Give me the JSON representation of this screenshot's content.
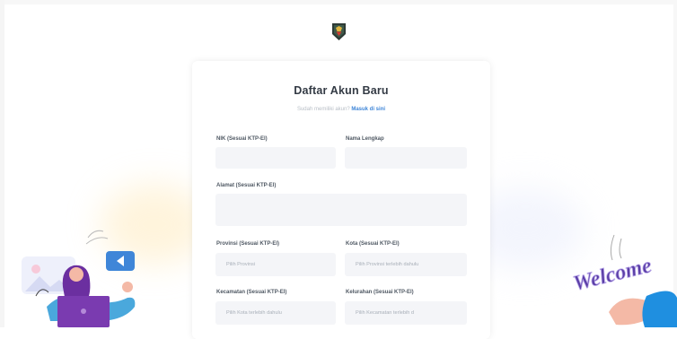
{
  "page": {
    "title": "Daftar Akun Baru",
    "subtitle_text": "Sudah memiliki akun?",
    "subtitle_link": "Masuk di sini"
  },
  "form": {
    "fields": [
      {
        "label": "NIK (Sesuai KTP-El)",
        "value": "",
        "placeholder": ""
      },
      {
        "label": "Nama Lengkap",
        "value": "",
        "placeholder": ""
      },
      {
        "label": "Alamat (Sesuai KTP-El)",
        "value": "",
        "placeholder": ""
      },
      {
        "label": "Provinsi (Sesuai KTP-El)",
        "placeholder": "Pilih Provinsi"
      },
      {
        "label": "Kota (Sesuai KTP-El)",
        "placeholder": "Pilih Provinsi terlebih dahulu"
      },
      {
        "label": "Kecamatan (Sesuai KTP-El)",
        "placeholder": "Pilih Kota terlebih dahulu"
      },
      {
        "label": "Kelurahan (Sesuai KTP-El)",
        "placeholder": "Pilih Kecamatan terlebih d"
      }
    ]
  },
  "decor": {
    "welcome_text": "Welcome",
    "logo_icon": "shield-emblem-icon",
    "colors": {
      "accent_blue": "#3f86d8",
      "title": "#333a44",
      "field_bg": "#f4f5f8",
      "laptop_purple": "#7a3bb0",
      "welcome_purple": "#5b3ea6",
      "logo_dark": "#2d3a35",
      "logo_red": "#d23b30"
    }
  }
}
